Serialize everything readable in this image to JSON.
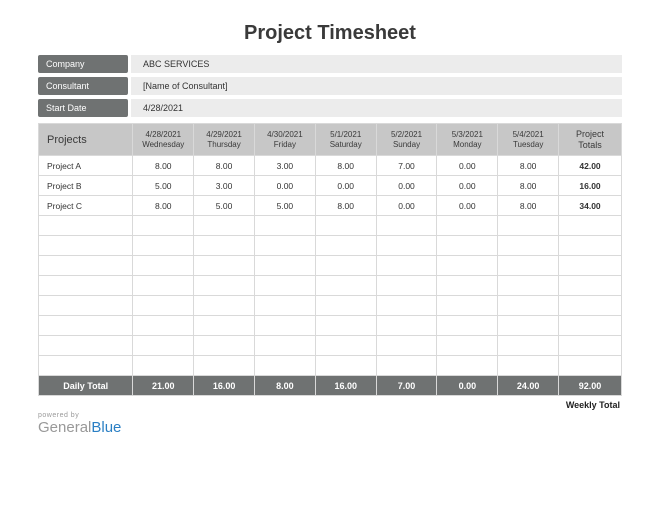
{
  "title": "Project Timesheet",
  "info": {
    "company_label": "Company",
    "company_value": "ABC SERVICES",
    "consultant_label": "Consultant",
    "consultant_value": "[Name of Consultant]",
    "startdate_label": "Start Date",
    "startdate_value": "4/28/2021"
  },
  "columns": {
    "projects_header": "Projects",
    "days": [
      {
        "date": "4/28/2021",
        "dow": "Wednesday"
      },
      {
        "date": "4/29/2021",
        "dow": "Thursday"
      },
      {
        "date": "4/30/2021",
        "dow": "Friday"
      },
      {
        "date": "5/1/2021",
        "dow": "Saturday"
      },
      {
        "date": "5/2/2021",
        "dow": "Sunday"
      },
      {
        "date": "5/3/2021",
        "dow": "Monday"
      },
      {
        "date": "5/4/2021",
        "dow": "Tuesday"
      }
    ],
    "totals_header_l1": "Project",
    "totals_header_l2": "Totals"
  },
  "rows": [
    {
      "name": "Project A",
      "v": [
        "8.00",
        "8.00",
        "3.00",
        "8.00",
        "7.00",
        "0.00",
        "8.00"
      ],
      "total": "42.00"
    },
    {
      "name": "Project B",
      "v": [
        "5.00",
        "3.00",
        "0.00",
        "0.00",
        "0.00",
        "0.00",
        "8.00"
      ],
      "total": "16.00"
    },
    {
      "name": "Project C",
      "v": [
        "8.00",
        "5.00",
        "5.00",
        "8.00",
        "0.00",
        "0.00",
        "8.00"
      ],
      "total": "34.00"
    }
  ],
  "empty_row_count": 8,
  "footer": {
    "label": "Daily Total",
    "v": [
      "21.00",
      "16.00",
      "8.00",
      "16.00",
      "7.00",
      "0.00",
      "24.00"
    ],
    "grand": "92.00"
  },
  "weekly_total_label": "Weekly Total",
  "brand": {
    "powered_by": "powered by",
    "name1": "General",
    "name2": "Blue"
  },
  "chart_data": {
    "type": "table",
    "title": "Project Timesheet",
    "columns": [
      "Project",
      "4/28/2021",
      "4/29/2021",
      "4/30/2021",
      "5/1/2021",
      "5/2/2021",
      "5/3/2021",
      "5/4/2021",
      "Project Totals"
    ],
    "rows": [
      [
        "Project A",
        8.0,
        8.0,
        3.0,
        8.0,
        7.0,
        0.0,
        8.0,
        42.0
      ],
      [
        "Project B",
        5.0,
        3.0,
        0.0,
        0.0,
        0.0,
        0.0,
        8.0,
        16.0
      ],
      [
        "Project C",
        8.0,
        5.0,
        5.0,
        8.0,
        0.0,
        0.0,
        8.0,
        34.0
      ],
      [
        "Daily Total",
        21.0,
        16.0,
        8.0,
        16.0,
        7.0,
        0.0,
        24.0,
        92.0
      ]
    ]
  }
}
